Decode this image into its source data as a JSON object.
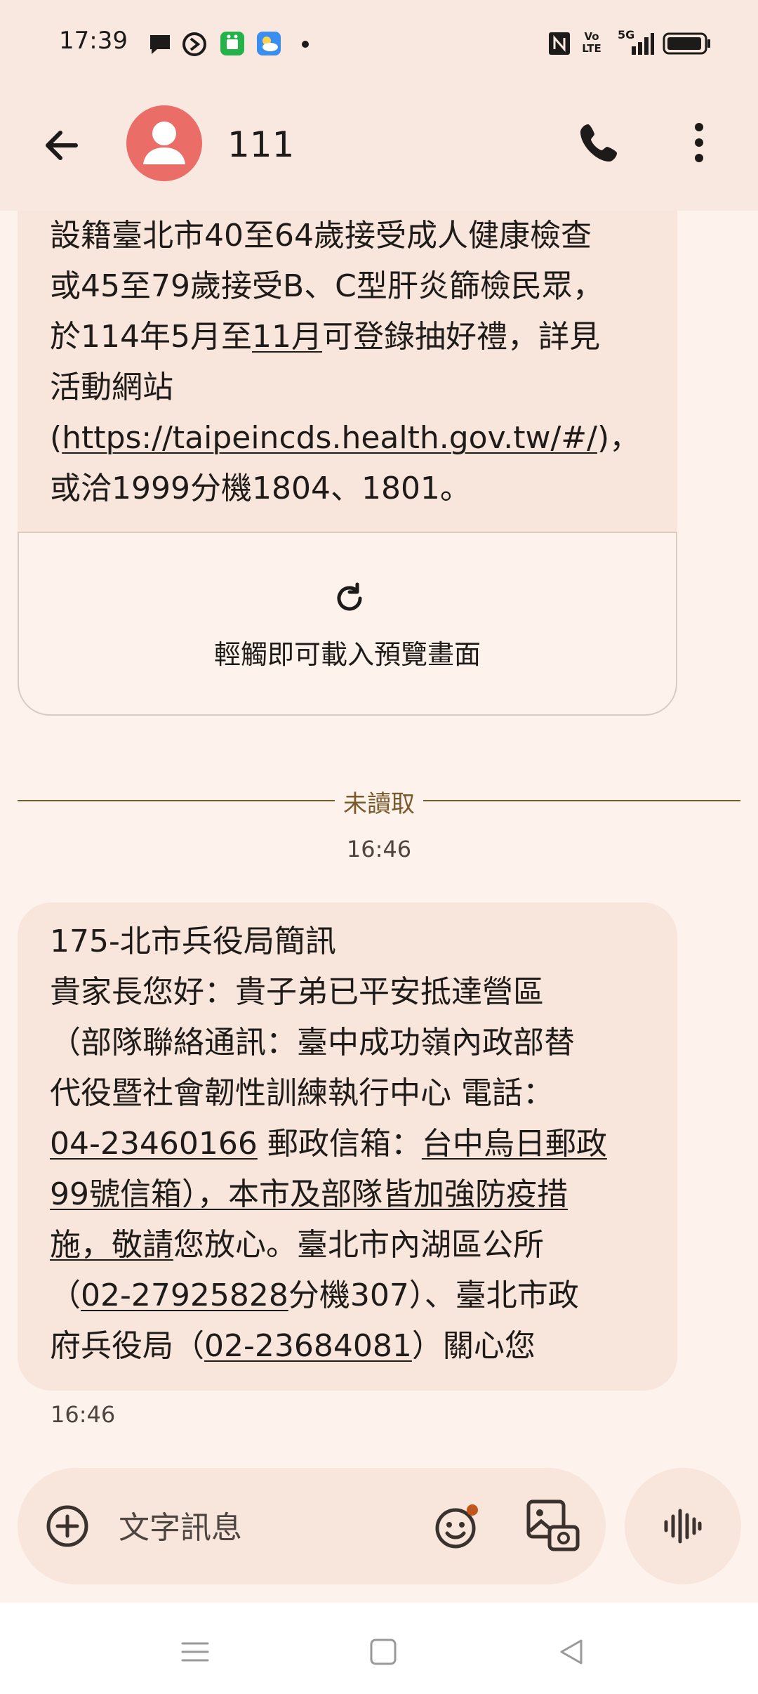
{
  "status_bar": {
    "time": "17:39",
    "notification_icons": [
      "chat-bubble-icon",
      "logo-circle-icon",
      "green-app-icon",
      "weather-icon",
      "dot-icon"
    ],
    "system_icons": [
      "nfc-icon",
      "volte-icon",
      "5g-signal-icon",
      "battery-icon"
    ],
    "network_label": "5G",
    "volte_label": "Vo LTE"
  },
  "app_bar": {
    "contact_name": "111"
  },
  "messages": [
    {
      "lines": [
        {
          "parts": [
            {
              "text": "設籍臺北市40至64歲接受成人健康檢查"
            }
          ]
        },
        {
          "parts": [
            {
              "text": "或45至79歲接受B、C型肝炎篩檢民眾，"
            }
          ]
        },
        {
          "parts": [
            {
              "text": "於114年5月至"
            },
            {
              "text": "11月",
              "link": true
            },
            {
              "text": "可登錄抽好禮，詳見"
            }
          ]
        },
        {
          "parts": [
            {
              "text": "活動網站"
            }
          ]
        },
        {
          "parts": [
            {
              "text": "("
            },
            {
              "text": "https://taipeincds.health.gov.tw/#/",
              "link": true
            },
            {
              "text": ")，"
            }
          ]
        },
        {
          "parts": [
            {
              "text": "或洽1999分機1804、1801。"
            }
          ]
        }
      ],
      "preview_text": "輕觸即可載入預覽畫面"
    },
    {
      "lines": [
        {
          "parts": [
            {
              "text": "175-北市兵役局簡訊"
            }
          ]
        },
        {
          "parts": [
            {
              "text": "貴家長您好：貴子弟已平安抵達營區"
            }
          ]
        },
        {
          "parts": [
            {
              "text": "（部隊聯絡通訊：臺中成功嶺內政部替"
            }
          ]
        },
        {
          "parts": [
            {
              "text": "代役暨社會韌性訓練執行中心 電話："
            }
          ]
        },
        {
          "parts": [
            {
              "text": "04-23460166",
              "link": true
            },
            {
              "text": " 郵政信箱："
            },
            {
              "text": "台中烏日郵政",
              "link": true
            }
          ]
        },
        {
          "parts": [
            {
              "text": "99號信箱），本市及部隊皆加強防疫措",
              "link": true
            }
          ]
        },
        {
          "parts": [
            {
              "text": "施，敬請",
              "link": true
            },
            {
              "text": "您放心。臺北市內湖區公所"
            }
          ]
        },
        {
          "parts": [
            {
              "text": "（"
            },
            {
              "text": "02-27925828",
              "link": true
            },
            {
              "text": "分機307）、臺北市政"
            }
          ]
        },
        {
          "parts": [
            {
              "text": "府兵役局（"
            },
            {
              "text": "02-23684081",
              "link": true
            },
            {
              "text": "）關心您"
            }
          ]
        }
      ],
      "time": "16:46"
    }
  ],
  "unread_divider": {
    "label": "未讀取",
    "time": "16:46"
  },
  "composer": {
    "placeholder": "文字訊息"
  },
  "colors": {
    "background": "#fdf3ec",
    "header": "#f9e8df",
    "bubble": "#f8e6dd",
    "avatar": "#ea6d67",
    "divider": "#7a5a2a"
  }
}
